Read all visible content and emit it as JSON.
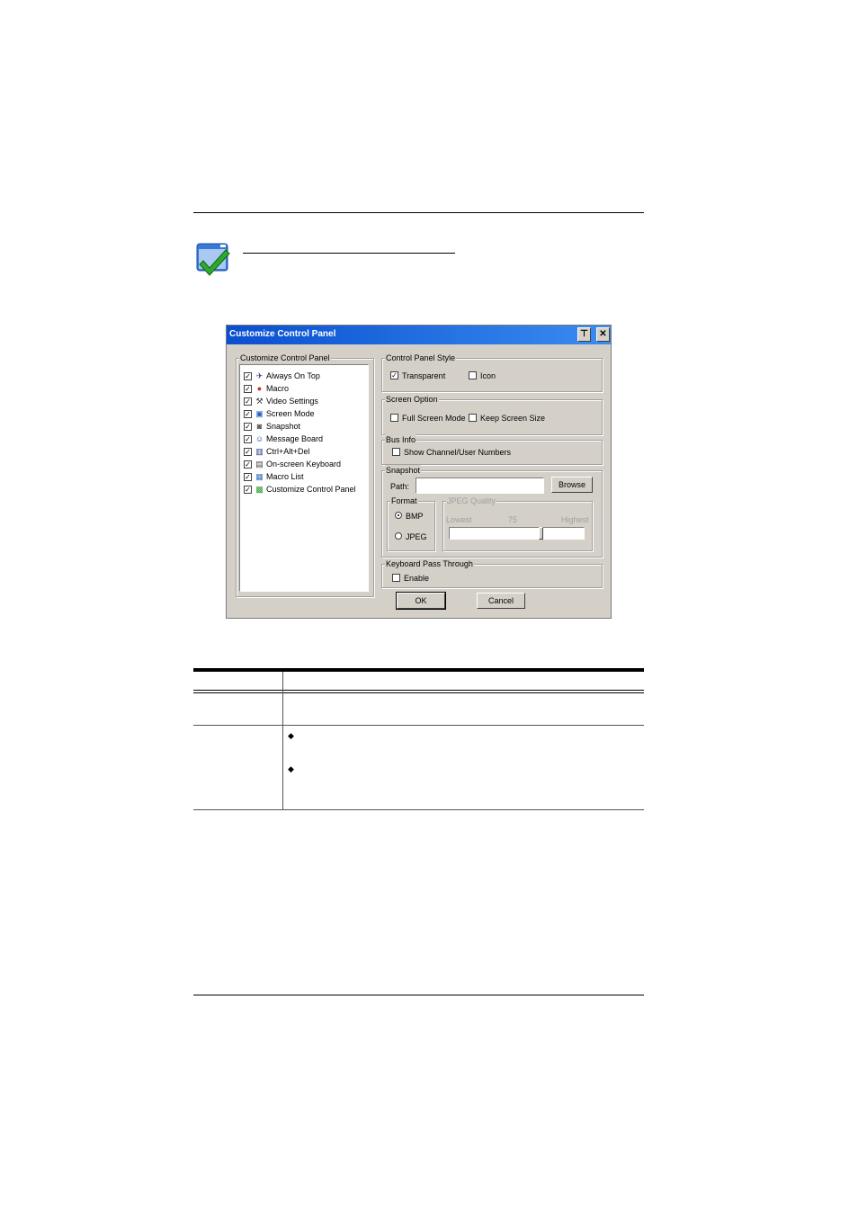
{
  "dialog": {
    "title": "Customize Control Panel",
    "pin_symbol": "⊤",
    "close_symbol": "✕",
    "left_group_label": "Customize Control Panel",
    "items": [
      {
        "label": "Always On Top",
        "checked": true,
        "icon": "pushpin-icon",
        "glyph": "✈"
      },
      {
        "label": "Macro",
        "checked": true,
        "icon": "macro-icon",
        "glyph": "●"
      },
      {
        "label": "Video Settings",
        "checked": true,
        "icon": "hammer-icon",
        "glyph": "⚒"
      },
      {
        "label": "Screen Mode",
        "checked": true,
        "icon": "screen-mode-icon",
        "glyph": "▣"
      },
      {
        "label": "Snapshot",
        "checked": true,
        "icon": "camera-icon",
        "glyph": "◙"
      },
      {
        "label": "Message Board",
        "checked": true,
        "icon": "message-board-icon",
        "glyph": "☺"
      },
      {
        "label": "Ctrl+Alt+Del",
        "checked": true,
        "icon": "ctrl-alt-del-icon",
        "glyph": "▥"
      },
      {
        "label": "On-screen Keyboard",
        "checked": true,
        "icon": "keyboard-icon",
        "glyph": "▤"
      },
      {
        "label": "Macro List",
        "checked": true,
        "icon": "macro-list-icon",
        "glyph": "▦"
      },
      {
        "label": "Customize Control Panel",
        "checked": true,
        "icon": "customize-icon",
        "glyph": "▩"
      }
    ],
    "control_panel_style": {
      "label": "Control Panel Style",
      "transparent_label": "Transparent",
      "transparent_checked": true,
      "icon_label": "Icon",
      "icon_checked": false
    },
    "screen_option": {
      "label": "Screen Option",
      "full_screen_label": "Full Screen Mode",
      "keep_size_label": "Keep Screen Size"
    },
    "bus_info": {
      "label": "Bus Info",
      "show_numbers_label": "Show Channel/User Numbers"
    },
    "snapshot": {
      "label": "Snapshot",
      "path_label": "Path:",
      "path_value": "",
      "browse_label": "Browse",
      "format_label": "Format",
      "bmp_label": "BMP",
      "jpeg_label": "JPEG",
      "selected_format": "BMP",
      "quality_label": "JPEG Quality",
      "lowest_label": "Lowest",
      "quality_value_label": "75",
      "highest_label": "Highest",
      "quality_value": 75
    },
    "keyboard_pass_through": {
      "label": "Keyboard Pass Through",
      "enable_label": "Enable"
    },
    "ok_label": "OK",
    "cancel_label": "Cancel"
  },
  "table": {
    "bullets": [
      "◆",
      "◆"
    ]
  }
}
